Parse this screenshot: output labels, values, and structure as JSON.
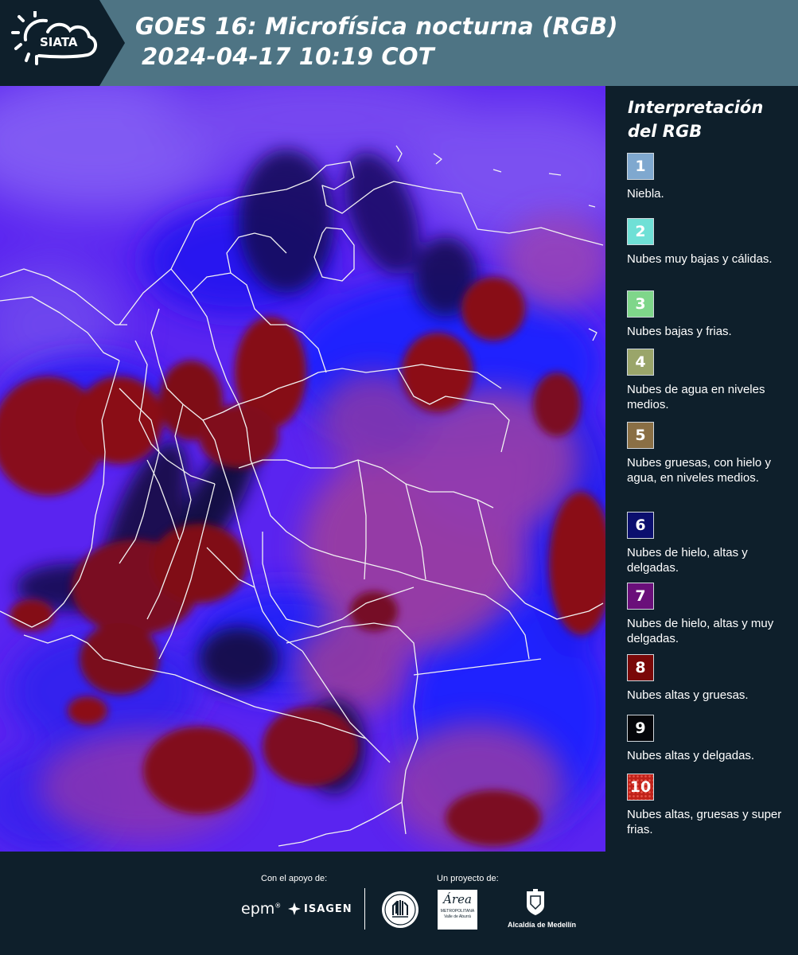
{
  "header": {
    "logo_text": "SIATA",
    "title_line1": "GOES 16: Microfísica nocturna (RGB)",
    "title_line2": "2024-04-17 10:19 COT"
  },
  "legend": {
    "title_line1": "Interpretación",
    "title_line2": "del RGB",
    "items": [
      {
        "num": "1",
        "color": "#7fa8cf",
        "text": "Niebla."
      },
      {
        "num": "2",
        "color": "#6fe0d6",
        "text": "Nubes muy bajas y cálidas."
      },
      {
        "num": "3",
        "color": "#7fd68a",
        "text": "Nubes bajas y frias."
      },
      {
        "num": "4",
        "color": "#9aa56a",
        "text": "Nubes de agua en niveles medios."
      },
      {
        "num": "5",
        "color": "#8a6f45",
        "text": "Nubes gruesas, con hielo y agua, en niveles medios."
      },
      {
        "num": "6",
        "color": "#0b0f6e",
        "text": "Nubes de hielo, altas y delgadas."
      },
      {
        "num": "7",
        "color": "#6a0f7a",
        "text": "Nubes de hielo, altas y muy delgadas."
      },
      {
        "num": "8",
        "color": "#7a0808",
        "text": "Nubes altas y gruesas."
      },
      {
        "num": "9",
        "color": "#05060a",
        "text": "Nubes altas y delgadas."
      },
      {
        "num": "10",
        "color": "#c0221a",
        "text": "Nubes altas, gruesas y super frias."
      }
    ]
  },
  "footer": {
    "support_label": "Con el apoyo de:",
    "project_label": "Un proyecto de:",
    "sponsor_epm": "epm",
    "sponsor_isagen": "ISAGEN",
    "area_logo_big": "Área",
    "area_logo_line1": "METROPOLITANA",
    "area_logo_line2": "Valle de Aburrá",
    "alcaldia": "Alcaldía de Medellín"
  }
}
